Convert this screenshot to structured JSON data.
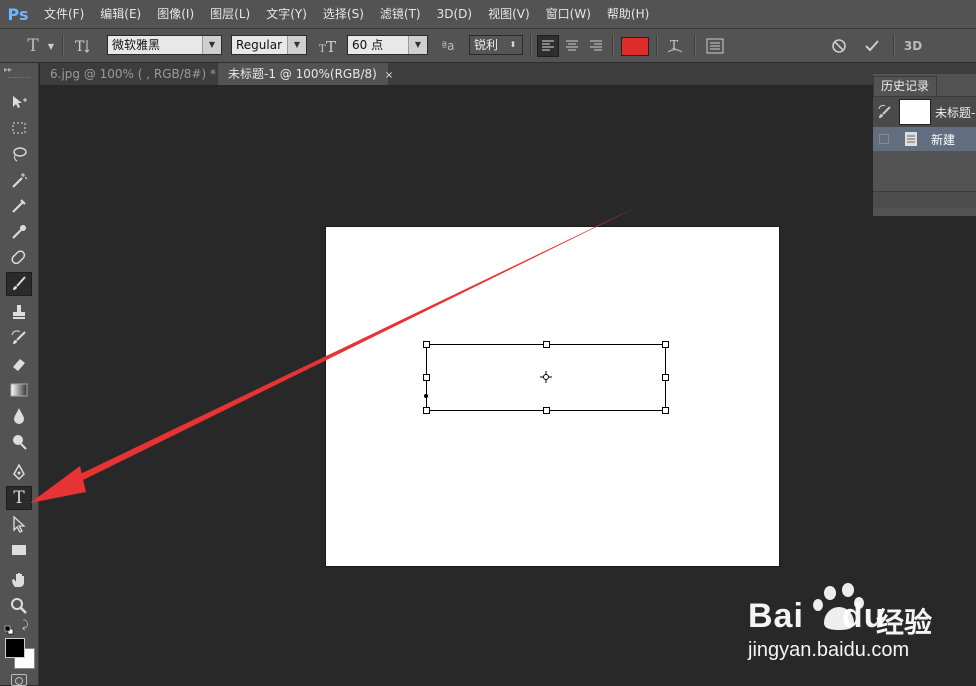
{
  "menubar": {
    "logo": "Ps",
    "items": [
      "文件(F)",
      "编辑(E)",
      "图像(I)",
      "图层(L)",
      "文字(Y)",
      "选择(S)",
      "滤镜(T)",
      "3D(D)",
      "视图(V)",
      "窗口(W)",
      "帮助(H)"
    ]
  },
  "options": {
    "font_family": "微软雅黑",
    "font_style": "Regular",
    "font_size": "60 点",
    "aa_label": "ªa",
    "antialias": "锐利",
    "text_color": "#e02b2b",
    "threed_label": "3D"
  },
  "tabs": [
    {
      "label": "6.jpg @ 100% ( , RGB/8#) *",
      "close": "×",
      "active": false
    },
    {
      "label": "未标题-1 @ 100%(RGB/8)",
      "close": "×",
      "active": true
    }
  ],
  "history_panel": {
    "tab_label": "历史记录",
    "snapshot_label": "未标题-",
    "step_label": "新建"
  },
  "watermark": {
    "brand": "Bai",
    "brand_tail": "du",
    "cn": "经验",
    "url": "jingyan.baidu.com"
  },
  "colors": {
    "arrow": "#e63333",
    "foreground": "#000000",
    "background": "#ffffff"
  }
}
